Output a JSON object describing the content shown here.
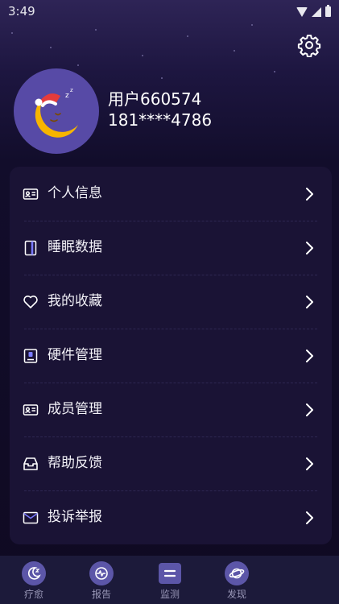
{
  "status_bar": {
    "time": "3:49"
  },
  "profile": {
    "username": "用户660574",
    "phone": "181****4786"
  },
  "menu": [
    {
      "label": "个人信息",
      "icon": "id-card-icon"
    },
    {
      "label": "睡眠数据",
      "icon": "document-icon"
    },
    {
      "label": "我的收藏",
      "icon": "heart-icon"
    },
    {
      "label": "硬件管理",
      "icon": "device-icon"
    },
    {
      "label": "成员管理",
      "icon": "id-card-icon"
    },
    {
      "label": "帮助反馈",
      "icon": "inbox-icon"
    },
    {
      "label": "投诉举报",
      "icon": "mail-icon"
    }
  ],
  "tabs": [
    {
      "label": "疗愈",
      "icon": "moon-icon"
    },
    {
      "label": "报告",
      "icon": "pulse-icon"
    },
    {
      "label": "监测",
      "icon": "equals-icon"
    },
    {
      "label": "发现",
      "icon": "planet-icon"
    }
  ],
  "colors": {
    "background_top": "#2e2456",
    "background_bottom": "#0f0a22",
    "card": "#1a1335",
    "avatar_bg": "#574aa6",
    "moon": "#f7b500",
    "tab_bar": "#1c1a3a"
  }
}
